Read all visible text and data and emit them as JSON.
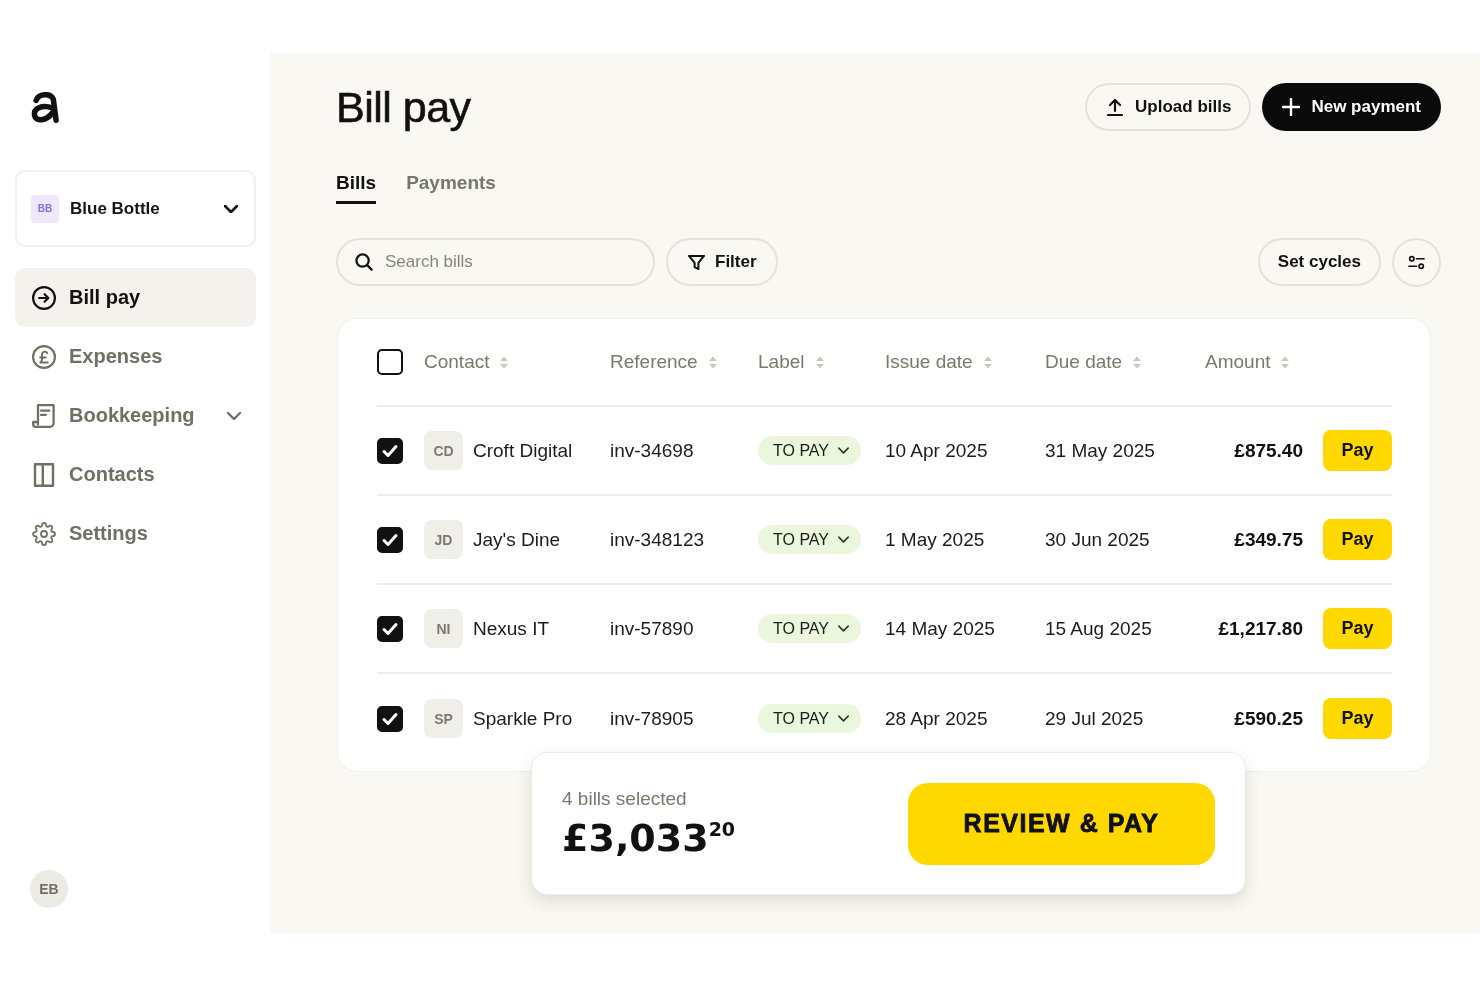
{
  "sidebar": {
    "organization": {
      "initials": "BB",
      "name": "Blue Bottle"
    },
    "nav": [
      {
        "label": "Bill pay",
        "selected": true
      },
      {
        "label": "Expenses",
        "selected": false
      },
      {
        "label": "Bookkeeping",
        "selected": false,
        "expanded": false
      },
      {
        "label": "Contacts",
        "selected": false
      },
      {
        "label": "Settings",
        "selected": false
      }
    ],
    "user": {
      "initials": "EB"
    }
  },
  "header": {
    "title": "Bill pay",
    "actions": [
      {
        "label": "Upload bills",
        "kind": "secondary"
      },
      {
        "label": "New payment",
        "kind": "primary"
      }
    ]
  },
  "tabs": [
    {
      "label": "Bills",
      "selected": true
    },
    {
      "label": "Payments",
      "selected": false
    }
  ],
  "toolbar": {
    "search": {
      "placeholder": "Search bills"
    },
    "filter": "Filter",
    "set_cycles": "Set cycles"
  },
  "table": {
    "select_all": {
      "checked": false
    },
    "columns": [
      "Contact",
      "Reference",
      "Label",
      "Issue date",
      "Due date",
      "Amount"
    ],
    "rows": [
      {
        "checked": true,
        "initials": "CD",
        "contact": "Croft Digital",
        "reference": "inv-34698",
        "label": "TO PAY",
        "issue_date": "10 Apr 2025",
        "due_date": "31 May 2025",
        "amount": "£875.40",
        "action": "Pay"
      },
      {
        "checked": true,
        "initials": "JD",
        "contact": "Jay's Dine",
        "reference": "inv-348123",
        "label": "TO PAY",
        "issue_date": "1 May 2025",
        "due_date": "30 Jun 2025",
        "amount": "£349.75",
        "action": "Pay"
      },
      {
        "checked": true,
        "initials": "NI",
        "contact": "Nexus IT",
        "reference": "inv-57890",
        "label": "TO PAY",
        "issue_date": "14 May 2025",
        "due_date": "15 Aug 2025",
        "amount": "£1,217.80",
        "action": "Pay"
      },
      {
        "checked": true,
        "initials": "SP",
        "contact": "Sparkle Pro",
        "reference": "inv-78905",
        "label": "TO PAY",
        "issue_date": "28 Apr 2025",
        "due_date": "29 Jul 2025",
        "amount": "£590.25",
        "action": "Pay"
      }
    ]
  },
  "selection_bar": {
    "count": "4 bills selected",
    "total": "£3,033$^{20}$",
    "action": "REVIEW & PAY"
  }
}
